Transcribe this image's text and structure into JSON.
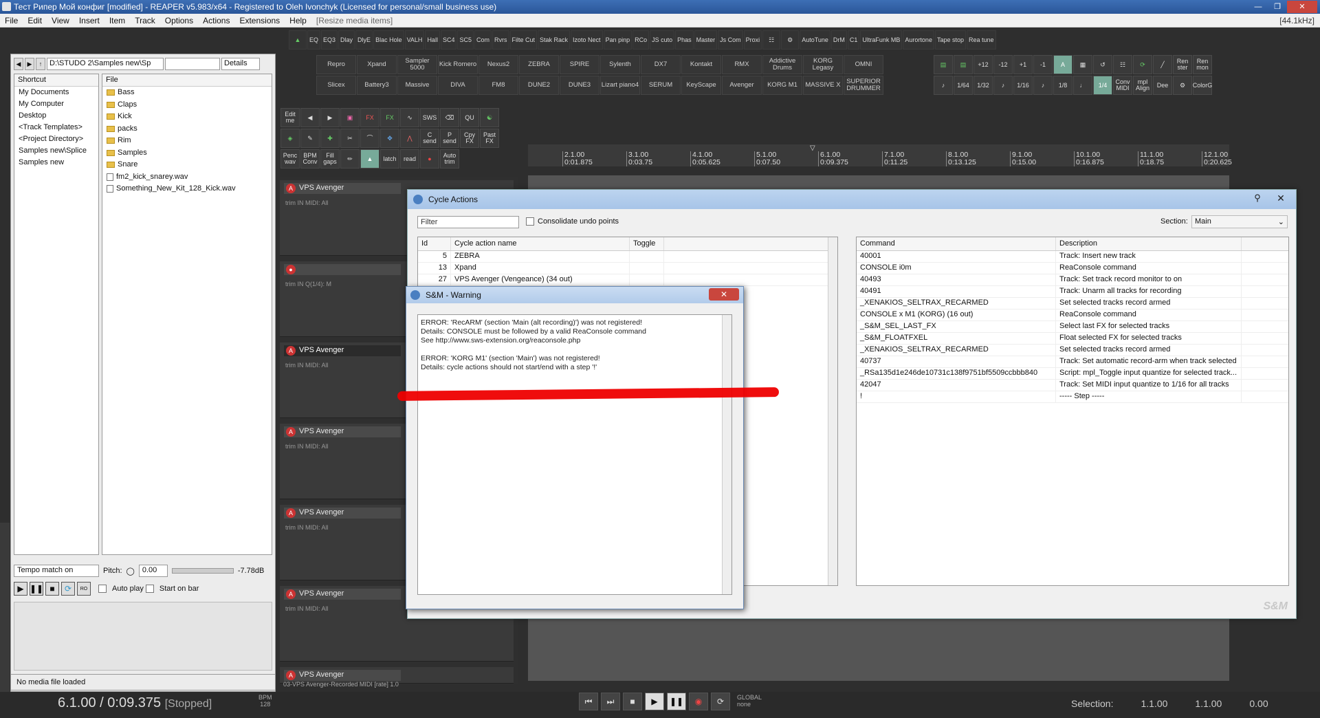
{
  "titlebar": {
    "title": "Тест Рипер Мой конфиг [modified] - REAPER v5.983/x64 - Registered to Oleh Ivonchyk (Licensed for personal/small business use)"
  },
  "menu": {
    "items": [
      "File",
      "Edit",
      "View",
      "Insert",
      "Item",
      "Track",
      "Options",
      "Actions",
      "Extensions",
      "Help",
      "[Resize media items]"
    ],
    "freq": "[44.1kHz]"
  },
  "toolbar1": [
    "EQ",
    "EQ3",
    "Dlay",
    "DlyE",
    "Blac Hole",
    "VALH",
    "Hall",
    "SC4",
    "SC5",
    "Com",
    "Rvrs",
    "Filte Cut",
    "Stak Rack",
    "Izoto Nect",
    "Pan pinp",
    "RCo",
    "JS cuto",
    "Phas",
    "Master",
    "Js Com",
    "Proxi",
    "",
    "",
    "AutoTune",
    "DrM",
    "C1",
    "UltraFunk MB",
    "Aurortone",
    "Tape stop",
    "Rea tune"
  ],
  "synth_row1": [
    "Repro",
    "Xpand",
    "Sampler 5000",
    "Kick Romero",
    "Nexus2",
    "ZEBRA",
    "SPIRE",
    "Sylenth",
    "DX7",
    "Kontakt",
    "RMX",
    "Addictive Drums",
    "KORG Legasy",
    "OMNI"
  ],
  "synth_row2": [
    "Slicex",
    "Battery3",
    "Massive",
    "DIVA",
    "FM8",
    "DUNE2",
    "DUNE3",
    "Lizart piano4",
    "SERUM",
    "KeyScape",
    "Avenger",
    "KORG M1",
    "MASSIVE X",
    "SUPERIOR DRUMMER"
  ],
  "right_toolbar": {
    "row1": [
      "+12",
      "-12",
      "+1",
      "-1",
      "Ren ster",
      "Ren mon"
    ],
    "row2": [
      "1/64",
      "1/32",
      "1/16",
      "1/8",
      "1/4",
      "Conv MIDI",
      "mpl Align",
      "Dee",
      "ColorG"
    ]
  },
  "edit_tools": {
    "row1": [
      "Edit me",
      "",
      "",
      "",
      "FX",
      "FX",
      "",
      "SWS",
      "",
      "QU",
      ""
    ],
    "row2": [
      "",
      "",
      "",
      "",
      "",
      "",
      "",
      "C send",
      "P send",
      "Cpy FX",
      "Past FX"
    ],
    "row3": [
      "Penc wav",
      "BPM Conv",
      "Fill gaps",
      "",
      "",
      "latch",
      "read",
      "",
      "Auto trim"
    ]
  },
  "explorer": {
    "path": "D:\\STUDO 2\\Samples new\\Sp",
    "view": "Details",
    "shortcut_header": "Shortcut",
    "file_header": "File",
    "shortcuts": [
      "My Documents",
      "My Computer",
      "Desktop",
      "<Track Templates>",
      "<Project Directory>",
      "Samples new\\Splice",
      "Samples new"
    ],
    "files": [
      {
        "name": "Bass",
        "type": "folder"
      },
      {
        "name": "Claps",
        "type": "folder"
      },
      {
        "name": "Kick",
        "type": "folder"
      },
      {
        "name": "packs",
        "type": "folder"
      },
      {
        "name": "Rim",
        "type": "folder"
      },
      {
        "name": "Samples",
        "type": "folder"
      },
      {
        "name": "Snare",
        "type": "folder"
      },
      {
        "name": "fm2_kick_snarey.wav",
        "type": "wav"
      },
      {
        "name": "Something_New_Kit_128_Kick.wav",
        "type": "wav"
      }
    ],
    "tempo": "Tempo match on",
    "pitch_label": "Pitch:",
    "pitch": "0.00",
    "volume": "-7.78dB",
    "autoplay": "Auto play",
    "startonbar": "Start on bar",
    "status": "No media file loaded"
  },
  "tracks": [
    {
      "name": "VPS Avenger",
      "sub": "trim  IN  MIDI: All"
    },
    {
      "name": "",
      "sub": "trim  IN  Q(1/4): M"
    },
    {
      "name": "VPS Avenger",
      "sub": "trim  IN  MIDI: All",
      "selected": true
    },
    {
      "name": "VPS Avenger",
      "sub": "trim  IN  MIDI: All"
    },
    {
      "name": "VPS Avenger",
      "sub": "trim  IN  MIDI: All"
    },
    {
      "name": "VPS Avenger",
      "sub": "trim  IN  MIDI: All"
    },
    {
      "name": "VPS Avenger",
      "sub": ""
    }
  ],
  "timeline": [
    {
      "bar": "2.1.00",
      "t": "0:01.875"
    },
    {
      "bar": "3.1.00",
      "t": "0:03.75"
    },
    {
      "bar": "4.1.00",
      "t": "0:05.625"
    },
    {
      "bar": "5.1.00",
      "t": "0:07.50"
    },
    {
      "bar": "6.1.00",
      "t": "0:09.375"
    },
    {
      "bar": "7.1.00",
      "t": "0:11.25"
    },
    {
      "bar": "8.1.00",
      "t": "0:13.125"
    },
    {
      "bar": "9.1.00",
      "t": "0:15.00"
    },
    {
      "bar": "10.1.00",
      "t": "0:16.875"
    },
    {
      "bar": "11.1.00",
      "t": "0:18.75"
    },
    {
      "bar": "12.1.00",
      "t": "0:20.625"
    }
  ],
  "cycle": {
    "title": "Cycle Actions",
    "filter_placeholder": "Filter",
    "consolidate": "Consolidate undo points",
    "section_label": "Section:",
    "section": "Main",
    "left_headers": [
      "Id",
      "Cycle action name",
      "Toggle"
    ],
    "left_rows": [
      {
        "id": "5",
        "name": "ZEBRA"
      },
      {
        "id": "13",
        "name": "Xpand"
      },
      {
        "id": "27",
        "name": "VPS Avenger (Vengeance) (34 out)"
      }
    ],
    "right_headers": [
      "Command",
      "Description"
    ],
    "right_rows": [
      [
        "40001",
        "Track: Insert new track"
      ],
      [
        "CONSOLE i0m",
        "ReaConsole command"
      ],
      [
        "40493",
        "Track: Set track record monitor to on"
      ],
      [
        "40491",
        "Track: Unarm all tracks for recording"
      ],
      [
        "_XENAKIOS_SELTRAX_RECARMED",
        "Set selected tracks record armed"
      ],
      [
        "CONSOLE x M1 (KORG) (16 out)",
        "ReaConsole command"
      ],
      [
        "_S&M_SEL_LAST_FX",
        "Select last FX for selected tracks"
      ],
      [
        "_S&M_FLOATFXEL",
        "Float selected FX for selected tracks"
      ],
      [
        "_XENAKIOS_SELTRAX_RECARMED",
        "Set selected tracks record armed"
      ],
      [
        "40737",
        "Track: Set automatic record-arm when track selected"
      ],
      [
        "_RSa135d1e246de10731c138f9751bf5509ccbbb840",
        "Script: mpl_Toggle input quantize for selected track..."
      ],
      [
        "42047",
        "Track: Set MIDI input quantize to 1/16 for all tracks"
      ],
      [
        "!",
        "----- Step -----"
      ]
    ],
    "logo": "S&M"
  },
  "warning": {
    "title": "S&M - Warning",
    "lines": [
      "ERROR: 'RecARM' (section 'Main (alt recording)') was not registered!",
      "Details: CONSOLE must be followed by a valid ReaConsole command",
      "See http://www.sws-extension.org/reaconsole.php",
      "",
      "ERROR: 'KORG M1' (section 'Main') was not registered!",
      "Details: cycle actions should not start/end with a step '!'"
    ]
  },
  "transport": {
    "position": "6.1.00 / 0:09.375",
    "state": "[Stopped]",
    "bpm_label": "BPM",
    "bpm": "128",
    "selection_label": "Selection:",
    "sel_start": "1.1.00",
    "sel_end": "1.1.00",
    "sel_len": "0.00",
    "global": "GLOBAL",
    "none": "none",
    "track_info": "03-VPS Avenger-Recorded MIDI [rate] 1.0"
  },
  "colors": {
    "accent": "#2a5699",
    "warn_close": "#c9463d",
    "record": "#cc3333",
    "redline": "#ee0000"
  }
}
